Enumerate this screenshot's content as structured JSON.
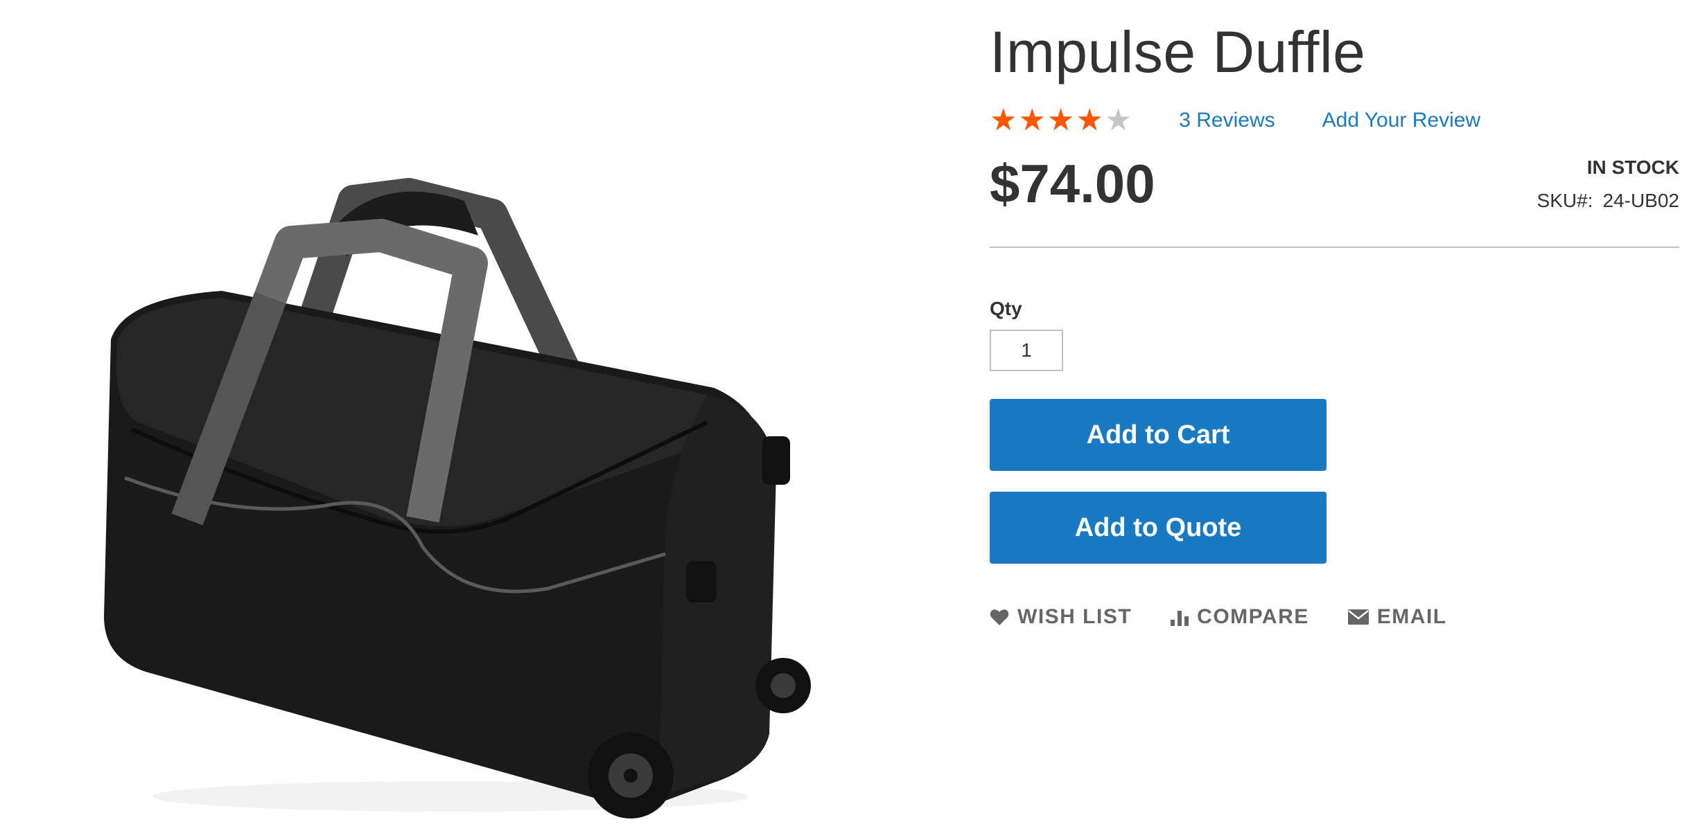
{
  "product": {
    "title": "Impulse Duffle",
    "rating": {
      "stars_filled": 4,
      "stars_total": 5,
      "symbols": "★★★★★"
    },
    "reviews_link": "3 Reviews",
    "add_review_link": "Add Your Review",
    "price": "$74.00",
    "stock_status": "IN STOCK",
    "sku_label": "SKU#:",
    "sku_value": "24-UB02",
    "image_alt": "Impulse Duffle",
    "image_icon": "duffle-bag-image"
  },
  "form": {
    "qty_label": "Qty",
    "qty_value": "1",
    "add_to_cart": "Add to Cart",
    "add_to_quote": "Add to Quote"
  },
  "actions": {
    "wishlist": {
      "label": "WISH LIST",
      "icon": "heart-icon"
    },
    "compare": {
      "label": "COMPARE",
      "icon": "bar-chart-icon"
    },
    "email": {
      "label": "EMAIL",
      "icon": "envelope-icon"
    }
  },
  "colors": {
    "accent": "#1979c3",
    "star": "#ff5501",
    "star_empty": "#c7c7c7",
    "text": "#333333",
    "muted": "#666666"
  }
}
